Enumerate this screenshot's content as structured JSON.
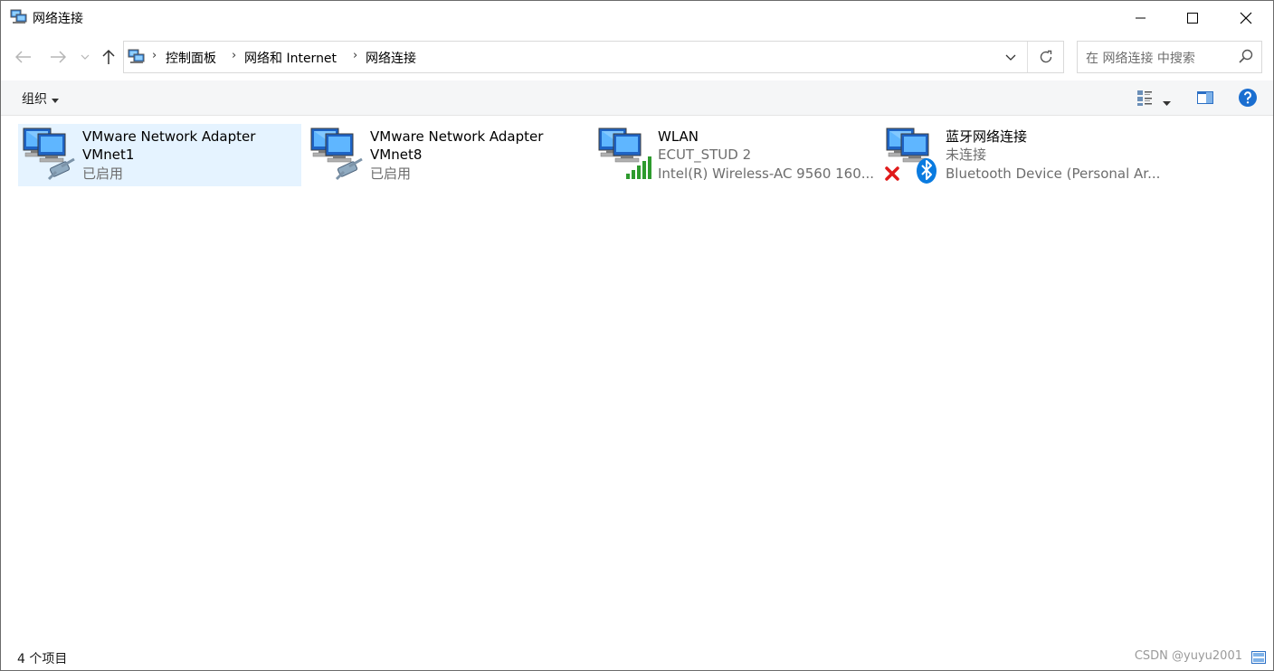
{
  "window": {
    "title": "网络连接"
  },
  "navigation": {
    "back_icon": "arrow-left-icon",
    "forward_icon": "arrow-right-icon",
    "recent_icon": "chevron-down-icon",
    "up_icon": "arrow-up-icon",
    "breadcrumbs": [
      "控制面板",
      "网络和 Internet",
      "网络连接"
    ],
    "search_placeholder": "在 网络连接 中搜索"
  },
  "commandbar": {
    "organize_label": "组织"
  },
  "connections": [
    {
      "name": "VMware Network Adapter",
      "line2": "VMnet1",
      "line3": "已启用",
      "icon": "network-cable-icon",
      "selected": true
    },
    {
      "name": "VMware Network Adapter",
      "line2": "VMnet8",
      "line3": "已启用",
      "icon": "network-cable-icon",
      "selected": false
    },
    {
      "name": "WLAN",
      "line2": "ECUT_STUD 2",
      "line3": "Intel(R) Wireless-AC 9560 160...",
      "icon": "wifi-signal-icon",
      "selected": false
    },
    {
      "name": "蓝牙网络连接",
      "line2": "未连接",
      "line3": "Bluetooth Device (Personal Ar...",
      "icon": "bluetooth-icon",
      "selected": false
    }
  ],
  "status": {
    "item_count": "4 个项目",
    "watermark": "CSDN @yuyu2001"
  },
  "colors": {
    "selection": "#e5f3ff",
    "accent": "#0063b1",
    "help": "#1a6ed0"
  }
}
